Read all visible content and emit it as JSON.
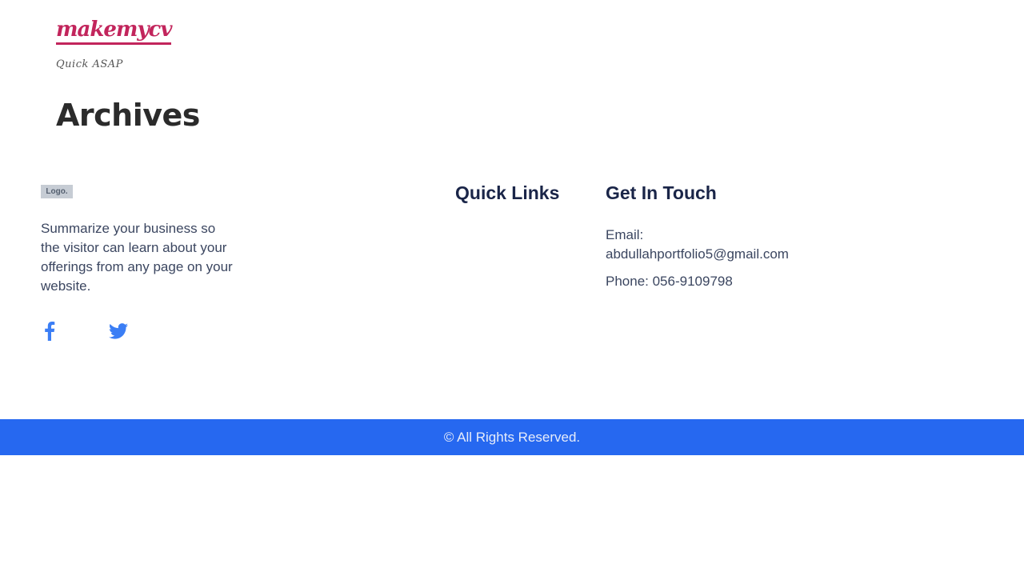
{
  "header": {
    "brand_name": "makemycv",
    "tagline": "Quick ASAP",
    "brand_color": "#c2255c"
  },
  "main": {
    "title": "Archives"
  },
  "footer": {
    "logo_text": "Logo.",
    "summary": "Summarize your business so the visitor can learn about your offerings from any page on your website.",
    "social": [
      {
        "icon": "facebook-icon",
        "color": "#3b7ef5"
      },
      {
        "icon": "twitter-icon",
        "color": "#3b7ef5"
      }
    ],
    "quick_links": {
      "heading": "Quick Links"
    },
    "contact": {
      "heading": "Get In Touch",
      "email_label": "Email:",
      "email_value": "abdullahportfolio5@gmail.com",
      "phone": "Phone: 056-9109798"
    }
  },
  "copyright": {
    "text": "© All Rights Reserved.",
    "bar_color": "#2668f0"
  }
}
